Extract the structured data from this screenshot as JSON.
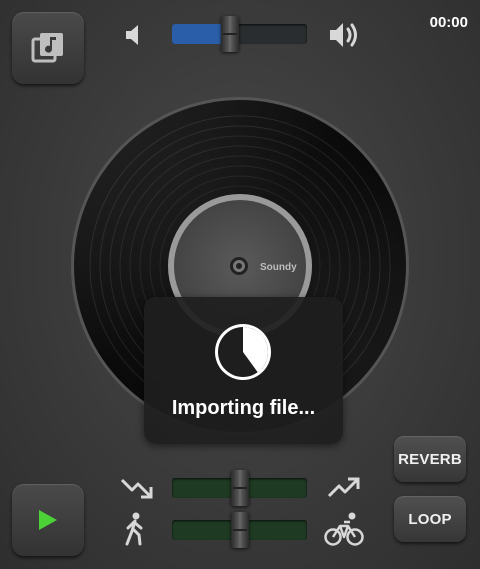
{
  "header": {
    "time": "00:00",
    "volume": {
      "value": 0.43,
      "fill_color": "#2b5ea8"
    }
  },
  "record": {
    "label_text": "Soundy"
  },
  "hud": {
    "message": "Importing file...",
    "progress": 0.4
  },
  "controls": {
    "pitch": {
      "value": 0.5,
      "low_icon": "trend-down-icon",
      "high_icon": "trend-up-icon"
    },
    "tempo": {
      "value": 0.5,
      "low_icon": "walker-icon",
      "high_icon": "bicycle-icon"
    },
    "reverb_label": "REVERB",
    "loop_label": "LOOP"
  },
  "colors": {
    "play_accent": "#4cd137",
    "slider_track_green": "#1f3a23",
    "background": "#3a3a3a"
  }
}
